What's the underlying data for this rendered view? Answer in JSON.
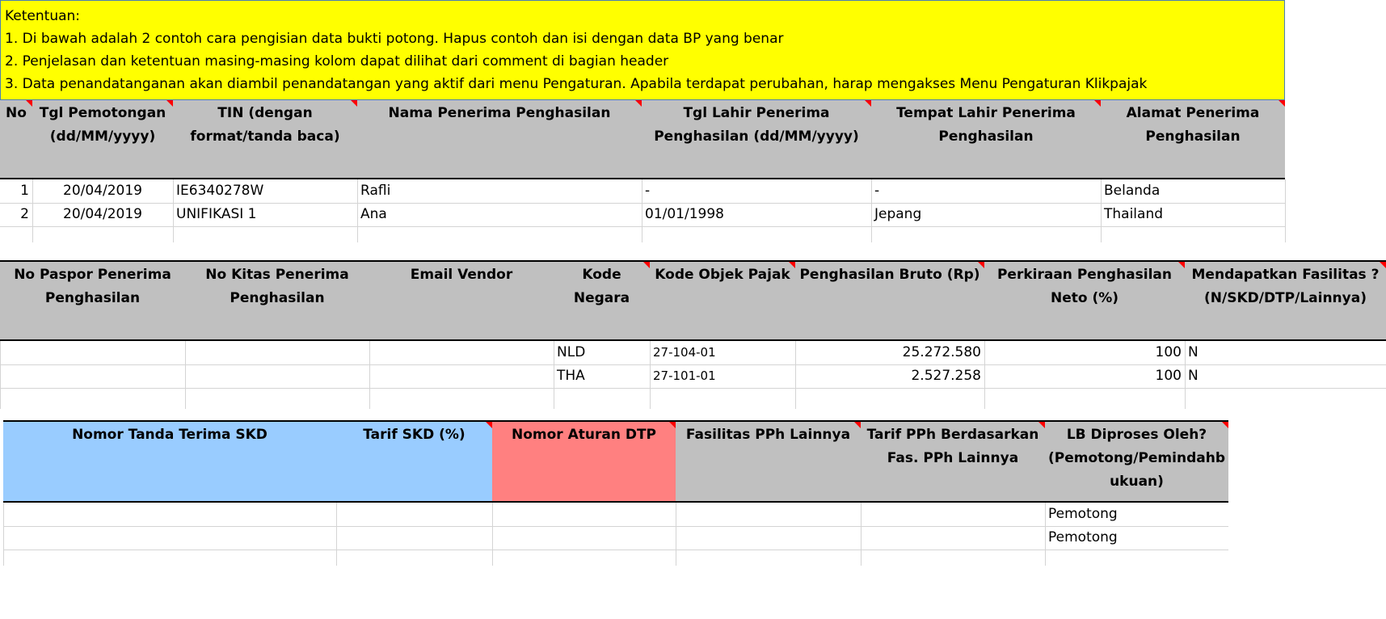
{
  "notes": {
    "title": "Ketentuan:",
    "lines": [
      "1. Di bawah adalah 2 contoh cara pengisian data bukti potong. Hapus contoh dan isi dengan data BP yang benar",
      "2. Penjelasan dan ketentuan masing-masing kolom dapat dilihat dari comment di bagian header",
      "3. Data penandatanganan akan diambil penandatangan yang aktif dari menu Pengaturan. Apabila terdapat perubahan, harap mengakses Menu Pengaturan Klikpajak"
    ],
    "background_color": "#ffff00"
  },
  "table1": {
    "headers": {
      "no": "No",
      "tgl_pemotongan": [
        "Tgl Pemotongan",
        "(dd/MM/yyyy)"
      ],
      "tin": [
        "TIN (dengan",
        "format/tanda baca)"
      ],
      "nama": [
        "Nama Penerima Penghasilan"
      ],
      "tgl_lahir": [
        "Tgl Lahir Penerima",
        "Penghasilan (dd/MM/yyyy)"
      ],
      "tempat_lahir": [
        "Tempat Lahir Penerima",
        "Penghasilan"
      ],
      "alamat": [
        "Alamat Penerima",
        "Penghasilan"
      ]
    },
    "rows": [
      {
        "no": "1",
        "tgl": "20/04/2019",
        "tin": "IE6340278W",
        "nama": "Rafli",
        "tgl_lahir": "-",
        "tempat_lahir": "-",
        "alamat": "Belanda"
      },
      {
        "no": "2",
        "tgl": "20/04/2019",
        "tin": "UNIFIKASI 1",
        "nama": "Ana",
        "tgl_lahir": "01/01/1998",
        "tempat_lahir": "Jepang",
        "alamat": "Thailand"
      }
    ]
  },
  "table2": {
    "headers": {
      "paspor": [
        "No Paspor Penerima",
        "Penghasilan"
      ],
      "kitas": [
        "No Kitas Penerima",
        "Penghasilan"
      ],
      "email": [
        "Email Vendor"
      ],
      "kode_negara": [
        "Kode",
        "Negara"
      ],
      "kode_objek": [
        "Kode Objek Pajak"
      ],
      "bruto": [
        "Penghasilan Bruto (Rp)"
      ],
      "neto": [
        "Perkiraan Penghasilan",
        "Neto (%)"
      ],
      "fasilitas": [
        "Mendapatkan Fasilitas ?",
        "(N/SKD/DTP/Lainnya)"
      ]
    },
    "rows": [
      {
        "kode_negara": "NLD",
        "kode_objek": "27-104-01",
        "bruto": "25.272.580",
        "neto": "100",
        "fasilitas": "N"
      },
      {
        "kode_negara": "THA",
        "kode_objek": "27-101-01",
        "bruto": "2.527.258",
        "neto": "100",
        "fasilitas": "N"
      }
    ]
  },
  "table3": {
    "headers": {
      "skd_no": [
        "Nomor Tanda Terima SKD"
      ],
      "tarif_skd": [
        "Tarif SKD (%)"
      ],
      "dtp": [
        "Nomor Aturan DTP"
      ],
      "fas_lain": [
        "Fasilitas PPh Lainnya"
      ],
      "tarif_fas": [
        "Tarif PPh Berdasarkan",
        "Fas. PPh Lainnya"
      ],
      "lb": [
        "LB Diproses Oleh?",
        "(Pemotong/Pemindahb",
        "ukuan)"
      ]
    },
    "rows": [
      {
        "lb": "Pemotong"
      },
      {
        "lb": "Pemotong"
      }
    ],
    "colors": {
      "skd": "#99ccff",
      "dtp": "#ff8080",
      "gray": "#c0c0c0"
    }
  }
}
